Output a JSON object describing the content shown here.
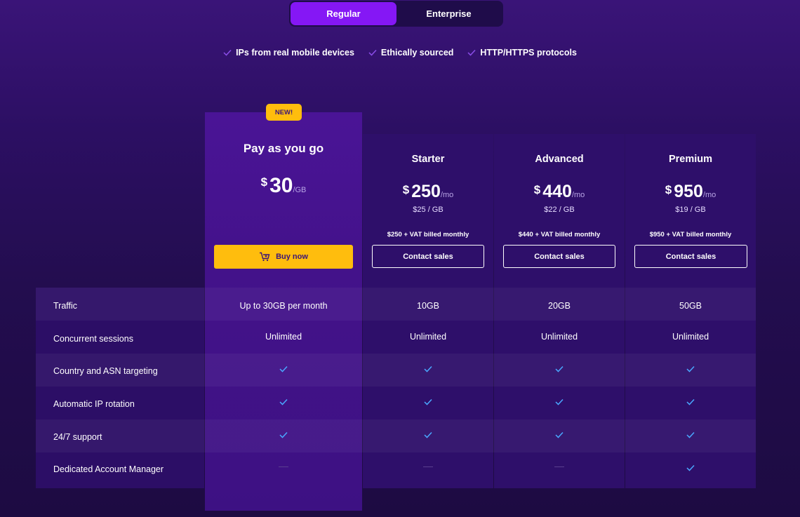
{
  "toggle": {
    "regular": "Regular",
    "enterprise": "Enterprise"
  },
  "features": [
    "IPs from real mobile devices",
    "Ethically sourced",
    "HTTP/HTTPS protocols"
  ],
  "colors": {
    "accent": "#8517f5",
    "buy_button": "#ffbd0d",
    "check": "#4aa8ff"
  },
  "plans": {
    "payg": {
      "badge": "NEW!",
      "name": "Pay as you go",
      "currency": "$",
      "price": "30",
      "unit": "/GB",
      "button": "Buy now",
      "button_icon": "cart-icon"
    },
    "starter": {
      "name": "Starter",
      "currency": "$",
      "price": "250",
      "unit": "/mo",
      "per_gb": "$25 / GB",
      "billed": "$250 + VAT billed monthly",
      "button": "Contact sales"
    },
    "advanced": {
      "name": "Advanced",
      "currency": "$",
      "price": "440",
      "unit": "/mo",
      "per_gb": "$22 / GB",
      "billed": "$440 + VAT billed monthly",
      "button": "Contact sales"
    },
    "premium": {
      "name": "Premium",
      "currency": "$",
      "price": "950",
      "unit": "/mo",
      "per_gb": "$19 / GB",
      "billed": "$950 + VAT billed monthly",
      "button": "Contact sales"
    }
  },
  "rows": [
    {
      "label": "Traffic",
      "values": [
        "Up to 30GB per month",
        "10GB",
        "20GB",
        "50GB"
      ]
    },
    {
      "label": "Concurrent sessions",
      "values": [
        "Unlimited",
        "Unlimited",
        "Unlimited",
        "Unlimited"
      ]
    },
    {
      "label": "Country and ASN targeting",
      "values": [
        "check",
        "check",
        "check",
        "check"
      ]
    },
    {
      "label": "Automatic IP rotation",
      "values": [
        "check",
        "check",
        "check",
        "check"
      ]
    },
    {
      "label": "24/7 support",
      "values": [
        "check",
        "check",
        "check",
        "check"
      ]
    },
    {
      "label": "Dedicated Account Manager",
      "values": [
        "dash",
        "dash",
        "dash",
        "check"
      ]
    }
  ]
}
